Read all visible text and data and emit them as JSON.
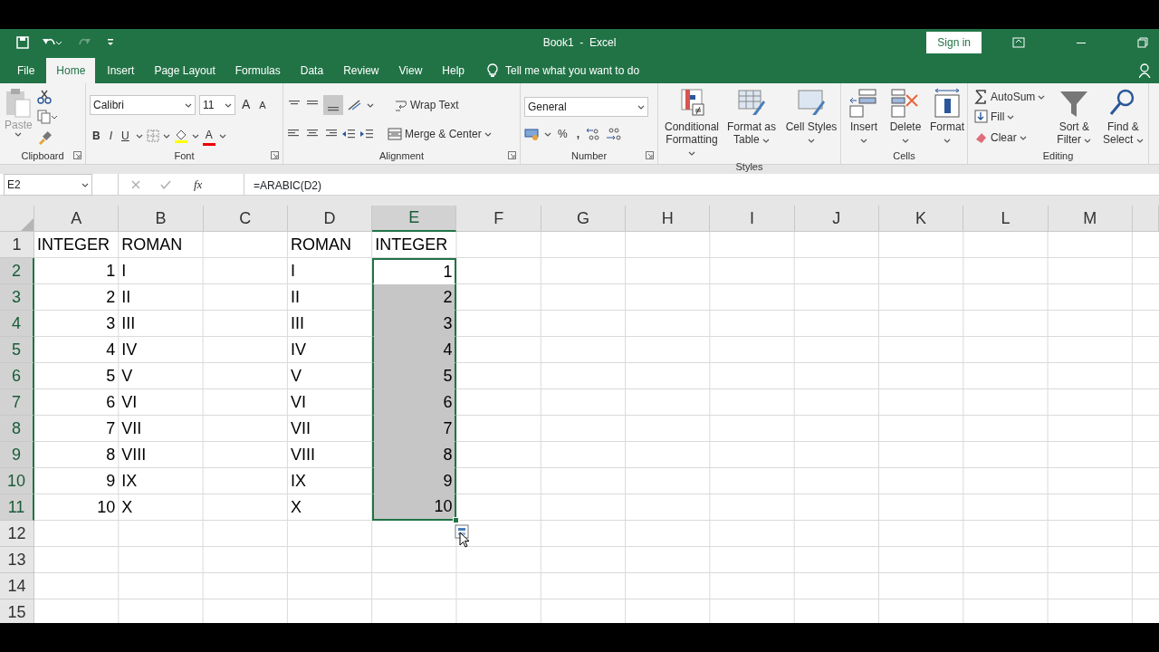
{
  "title_bar": {
    "title": "Book1  -  Excel",
    "sign_in": "Sign in"
  },
  "tabs": [
    {
      "label": "File",
      "selected": false
    },
    {
      "label": "Home",
      "selected": true
    },
    {
      "label": "Insert",
      "selected": false
    },
    {
      "label": "Page Layout",
      "selected": false
    },
    {
      "label": "Formulas",
      "selected": false
    },
    {
      "label": "Data",
      "selected": false
    },
    {
      "label": "Review",
      "selected": false
    },
    {
      "label": "View",
      "selected": false
    },
    {
      "label": "Help",
      "selected": false
    }
  ],
  "tell_me": "Tell me what you want to do",
  "ribbon": {
    "clipboard": {
      "label": "Clipboard",
      "paste": "Paste",
      "launcher": true
    },
    "font": {
      "label": "Font",
      "name": "Calibri",
      "size": "11",
      "grow": "A",
      "shrink": "A",
      "bold": "B",
      "italic": "I",
      "underline": "U",
      "font_color_button": "A",
      "launcher": true
    },
    "alignment": {
      "label": "Alignment",
      "wrap": "Wrap Text",
      "merge": "Merge & Center",
      "launcher": true
    },
    "number": {
      "label": "Number",
      "format": "General",
      "percent": "%",
      "comma": ",",
      "launcher": true
    },
    "styles": {
      "label": "Styles",
      "buttons": [
        {
          "label": "Conditional Formatting",
          "kind": "conditional"
        },
        {
          "label": "Format as Table",
          "kind": "table"
        },
        {
          "label": "Cell Styles",
          "kind": "cellstyles"
        }
      ]
    },
    "cells": {
      "label": "Cells",
      "buttons": [
        {
          "label": "Insert",
          "kind": "insert"
        },
        {
          "label": "Delete",
          "kind": "delete"
        },
        {
          "label": "Format",
          "kind": "format"
        }
      ]
    },
    "editing": {
      "label": "Editing",
      "small": [
        {
          "label": "AutoSum",
          "kind": "sum"
        },
        {
          "label": "Fill",
          "kind": "fill"
        },
        {
          "label": "Clear",
          "kind": "clear"
        }
      ],
      "buttons": [
        {
          "label": "Sort & Filter",
          "kind": "sort"
        },
        {
          "label": "Find & Select",
          "kind": "find"
        }
      ]
    }
  },
  "formula_bar": {
    "name_box": "E2",
    "fx": "fx",
    "formula": "=ARABIC(D2)"
  },
  "sheet": {
    "columns": [
      {
        "label": "A",
        "selected": false
      },
      {
        "label": "B",
        "selected": false
      },
      {
        "label": "C",
        "selected": false
      },
      {
        "label": "D",
        "selected": false
      },
      {
        "label": "E",
        "selected": true
      },
      {
        "label": "F",
        "selected": false
      },
      {
        "label": "G",
        "selected": false
      },
      {
        "label": "H",
        "selected": false
      },
      {
        "label": "I",
        "selected": false
      },
      {
        "label": "J",
        "selected": false
      },
      {
        "label": "K",
        "selected": false
      },
      {
        "label": "L",
        "selected": false
      },
      {
        "label": "M",
        "selected": false
      }
    ],
    "rows": [
      {
        "number": "1",
        "selected": false,
        "cells": {
          "A": {
            "text": "INTEGER",
            "kind": "text",
            "selected": false
          },
          "B": {
            "text": "ROMAN",
            "kind": "text",
            "selected": false
          },
          "D": {
            "text": "ROMAN",
            "kind": "text",
            "selected": false
          },
          "E": {
            "text": "INTEGER",
            "kind": "text",
            "selected": false
          }
        }
      },
      {
        "number": "2",
        "selected": true,
        "cells": {
          "A": {
            "text": "1",
            "kind": "number",
            "selected": false
          },
          "B": {
            "text": "I",
            "kind": "text",
            "selected": false
          },
          "D": {
            "text": "I",
            "kind": "text",
            "selected": false
          },
          "E": {
            "text": "1",
            "kind": "number",
            "selected": true,
            "active": true
          }
        }
      },
      {
        "number": "3",
        "selected": true,
        "cells": {
          "A": {
            "text": "2",
            "kind": "number",
            "selected": false
          },
          "B": {
            "text": "II",
            "kind": "text",
            "selected": false
          },
          "D": {
            "text": "II",
            "kind": "text",
            "selected": false
          },
          "E": {
            "text": "2",
            "kind": "number",
            "selected": true
          }
        }
      },
      {
        "number": "4",
        "selected": true,
        "cells": {
          "A": {
            "text": "3",
            "kind": "number",
            "selected": false
          },
          "B": {
            "text": "III",
            "kind": "text",
            "selected": false
          },
          "D": {
            "text": "III",
            "kind": "text",
            "selected": false
          },
          "E": {
            "text": "3",
            "kind": "number",
            "selected": true
          }
        }
      },
      {
        "number": "5",
        "selected": true,
        "cells": {
          "A": {
            "text": "4",
            "kind": "number",
            "selected": false
          },
          "B": {
            "text": "IV",
            "kind": "text",
            "selected": false
          },
          "D": {
            "text": "IV",
            "kind": "text",
            "selected": false
          },
          "E": {
            "text": "4",
            "kind": "number",
            "selected": true
          }
        }
      },
      {
        "number": "6",
        "selected": true,
        "cells": {
          "A": {
            "text": "5",
            "kind": "number",
            "selected": false
          },
          "B": {
            "text": "V",
            "kind": "text",
            "selected": false
          },
          "D": {
            "text": "V",
            "kind": "text",
            "selected": false
          },
          "E": {
            "text": "5",
            "kind": "number",
            "selected": true
          }
        }
      },
      {
        "number": "7",
        "selected": true,
        "cells": {
          "A": {
            "text": "6",
            "kind": "number",
            "selected": false
          },
          "B": {
            "text": "VI",
            "kind": "text",
            "selected": false
          },
          "D": {
            "text": "VI",
            "kind": "text",
            "selected": false
          },
          "E": {
            "text": "6",
            "kind": "number",
            "selected": true
          }
        }
      },
      {
        "number": "8",
        "selected": true,
        "cells": {
          "A": {
            "text": "7",
            "kind": "number",
            "selected": false
          },
          "B": {
            "text": "VII",
            "kind": "text",
            "selected": false
          },
          "D": {
            "text": "VII",
            "kind": "text",
            "selected": false
          },
          "E": {
            "text": "7",
            "kind": "number",
            "selected": true
          }
        }
      },
      {
        "number": "9",
        "selected": true,
        "cells": {
          "A": {
            "text": "8",
            "kind": "number",
            "selected": false
          },
          "B": {
            "text": "VIII",
            "kind": "text",
            "selected": false
          },
          "D": {
            "text": "VIII",
            "kind": "text",
            "selected": false
          },
          "E": {
            "text": "8",
            "kind": "number",
            "selected": true
          }
        }
      },
      {
        "number": "10",
        "selected": true,
        "cells": {
          "A": {
            "text": "9",
            "kind": "number",
            "selected": false
          },
          "B": {
            "text": "IX",
            "kind": "text",
            "selected": false
          },
          "D": {
            "text": "IX",
            "kind": "text",
            "selected": false
          },
          "E": {
            "text": "9",
            "kind": "number",
            "selected": true
          }
        }
      },
      {
        "number": "11",
        "selected": true,
        "cells": {
          "A": {
            "text": "10",
            "kind": "number",
            "selected": false
          },
          "B": {
            "text": "X",
            "kind": "text",
            "selected": false
          },
          "D": {
            "text": "X",
            "kind": "text",
            "selected": false
          },
          "E": {
            "text": "10",
            "kind": "number",
            "selected": true
          }
        }
      },
      {
        "number": "12",
        "selected": false
      },
      {
        "number": "13",
        "selected": false
      },
      {
        "number": "14",
        "selected": false
      },
      {
        "number": "15",
        "selected": false
      }
    ]
  }
}
